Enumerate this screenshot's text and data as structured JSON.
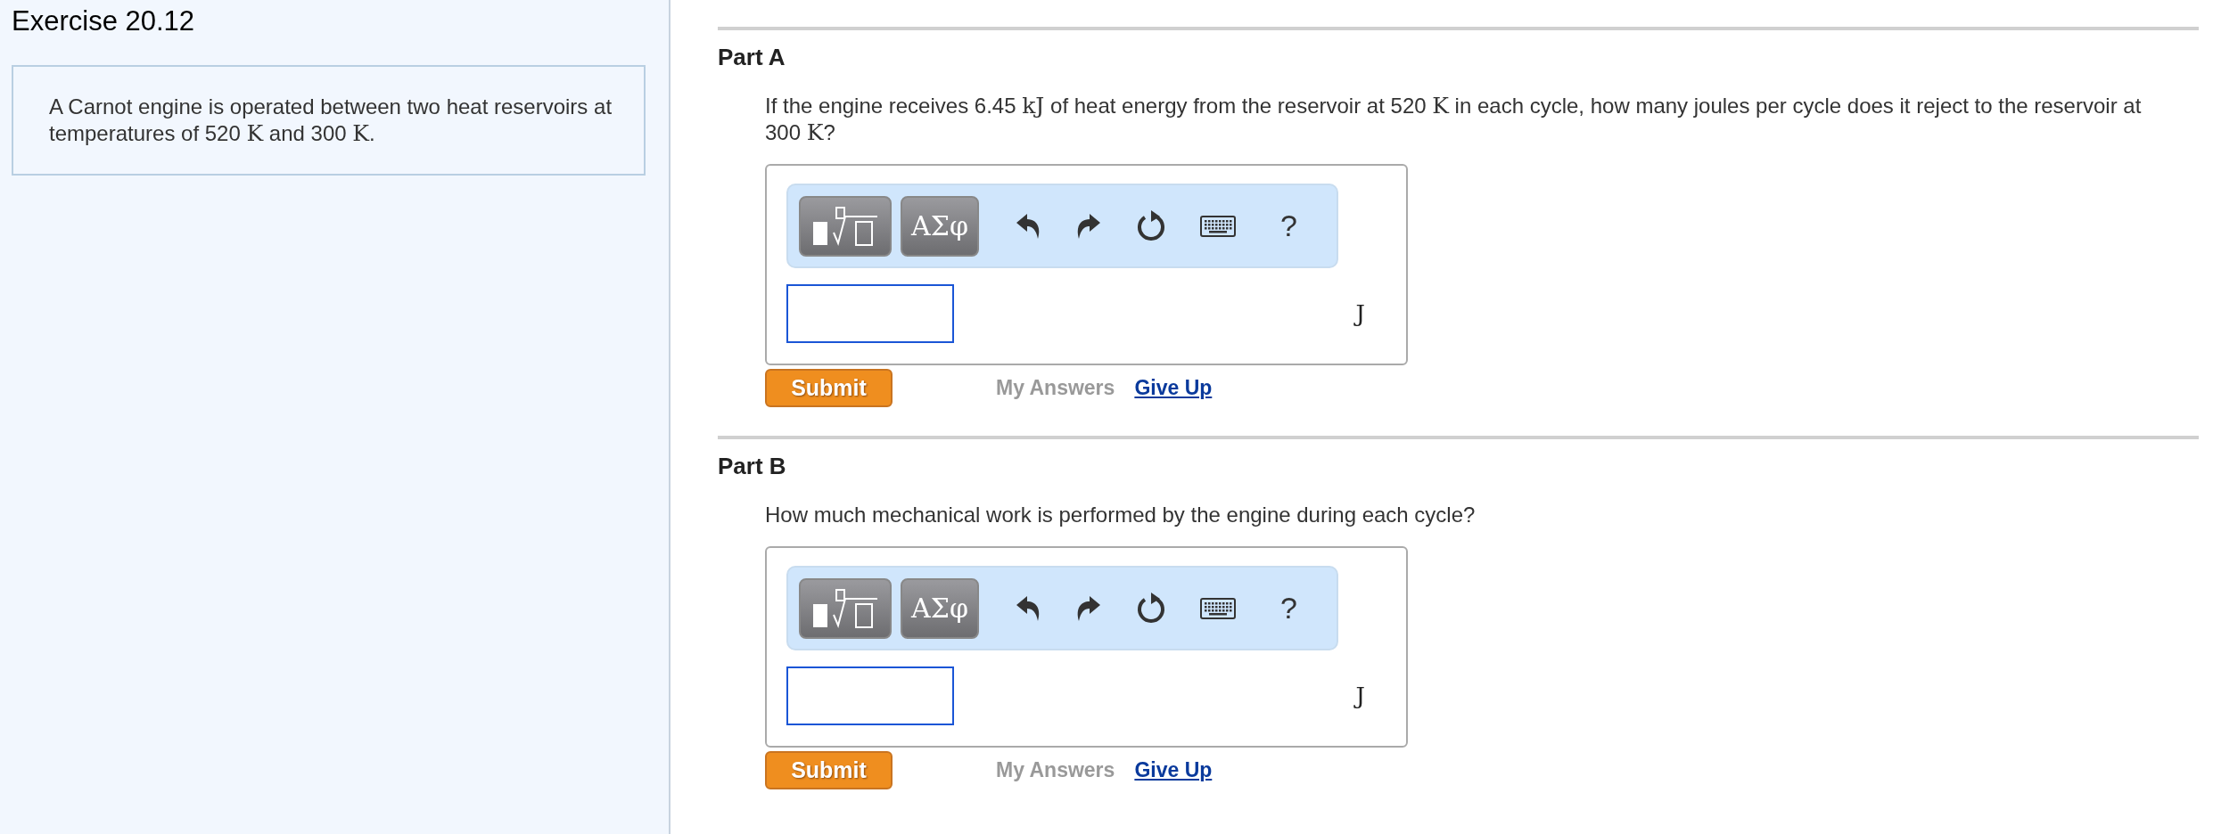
{
  "sidebar": {
    "title": "Exercise 20.12",
    "intro": [
      {
        "kind": "text",
        "text": "A Carnot engine is operated between two heat reservoirs at temperatures of 520 "
      },
      {
        "kind": "math",
        "text": "K"
      },
      {
        "kind": "text",
        "text": " and 300 "
      },
      {
        "kind": "math",
        "text": "K"
      },
      {
        "kind": "text",
        "text": "."
      }
    ]
  },
  "parts": [
    {
      "title": "Part A",
      "question": [
        {
          "kind": "text",
          "text": "If the engine receives 6.45 "
        },
        {
          "kind": "math",
          "text": "kJ"
        },
        {
          "kind": "text",
          "text": " of heat energy from the reservoir at 520 "
        },
        {
          "kind": "math",
          "text": "K"
        },
        {
          "kind": "text",
          "text": " in each cycle, how many joules per cycle does it reject to the reservoir at 300 "
        },
        {
          "kind": "math",
          "text": "K"
        },
        {
          "kind": "text",
          "text": "?"
        }
      ],
      "toolbar": {
        "symbols_label": "ΑΣφ",
        "help": "?"
      },
      "unit": "J",
      "submit": "Submit",
      "my_answers": "My Answers",
      "give_up": "Give Up"
    },
    {
      "title": "Part B",
      "question": [
        {
          "kind": "text",
          "text": "How much mechanical work is performed by the engine during each cycle?"
        }
      ],
      "toolbar": {
        "symbols_label": "ΑΣφ",
        "help": "?"
      },
      "unit": "J",
      "submit": "Submit",
      "my_answers": "My Answers",
      "give_up": "Give Up"
    }
  ]
}
